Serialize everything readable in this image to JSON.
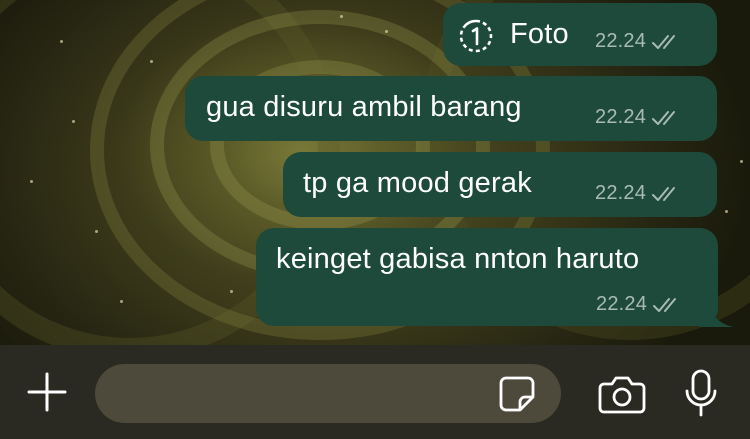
{
  "messages": [
    {
      "type": "photo",
      "text": "Foto",
      "time": "22.24",
      "status_icon": "double-check-icon",
      "media_icon": "view-once-icon"
    },
    {
      "type": "text",
      "text": "gua disuru ambil barang",
      "time": "22.24",
      "status_icon": "double-check-icon"
    },
    {
      "type": "text",
      "text": "tp ga mood gerak",
      "time": "22.24",
      "status_icon": "double-check-icon"
    },
    {
      "type": "text",
      "text": "keinget gabisa nnton haruto",
      "time": "22.24",
      "status_icon": "double-check-icon"
    }
  ],
  "composer": {
    "placeholder": "",
    "attach_icon": "plus-icon",
    "sticker_icon": "sticker-icon",
    "camera_icon": "camera-icon",
    "mic_icon": "microphone-icon"
  },
  "colors": {
    "bubble": "#1d4a3a",
    "composer_bar": "#2b2a22",
    "input_field": "#4d4a3b",
    "icon": "#ffffff"
  }
}
